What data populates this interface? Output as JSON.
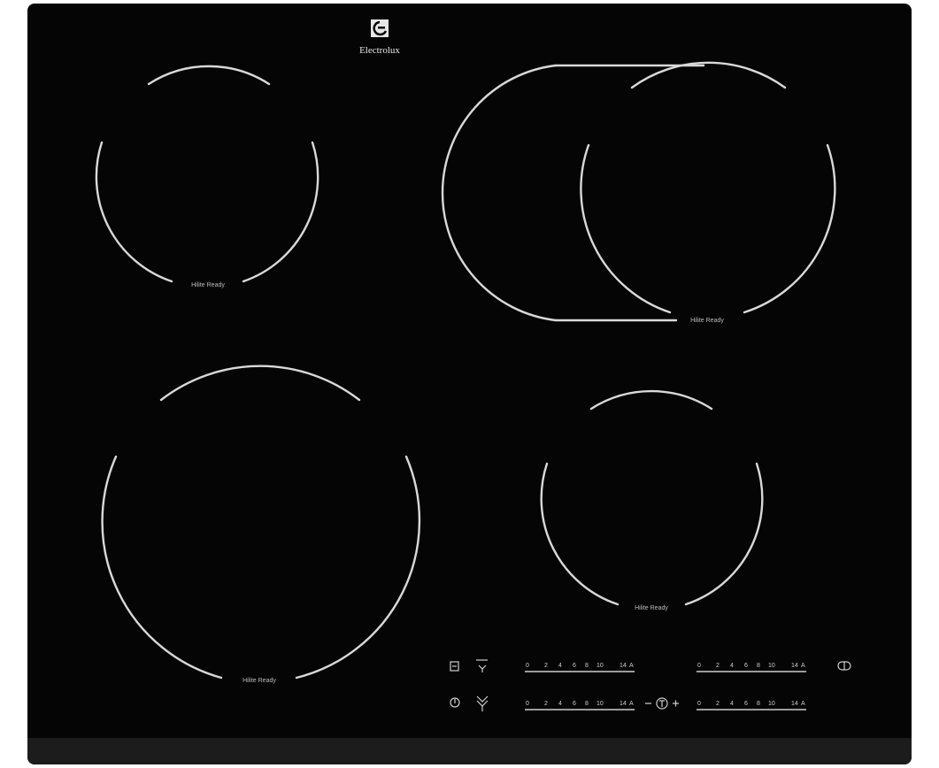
{
  "brand": {
    "name": "Electrolux"
  },
  "zones": [
    {
      "id": "front-left",
      "label": "Hilite Ready"
    },
    {
      "id": "rear-left",
      "label": "Hilite Ready"
    },
    {
      "id": "rear-right",
      "label": "Hilite Ready"
    },
    {
      "id": "front-right",
      "label": "Hilite Ready"
    }
  ],
  "sliders": {
    "ticks": [
      "0",
      "2",
      "4",
      "6",
      "8",
      "10",
      "14",
      "A"
    ]
  },
  "colors": {
    "glass": "#050505",
    "print": "#d9d9d9"
  },
  "icons": [
    "electrolux-logo-icon",
    "lock-icon",
    "power-icon",
    "bridge-icon",
    "timer-icon",
    "stopgo-icon"
  ]
}
